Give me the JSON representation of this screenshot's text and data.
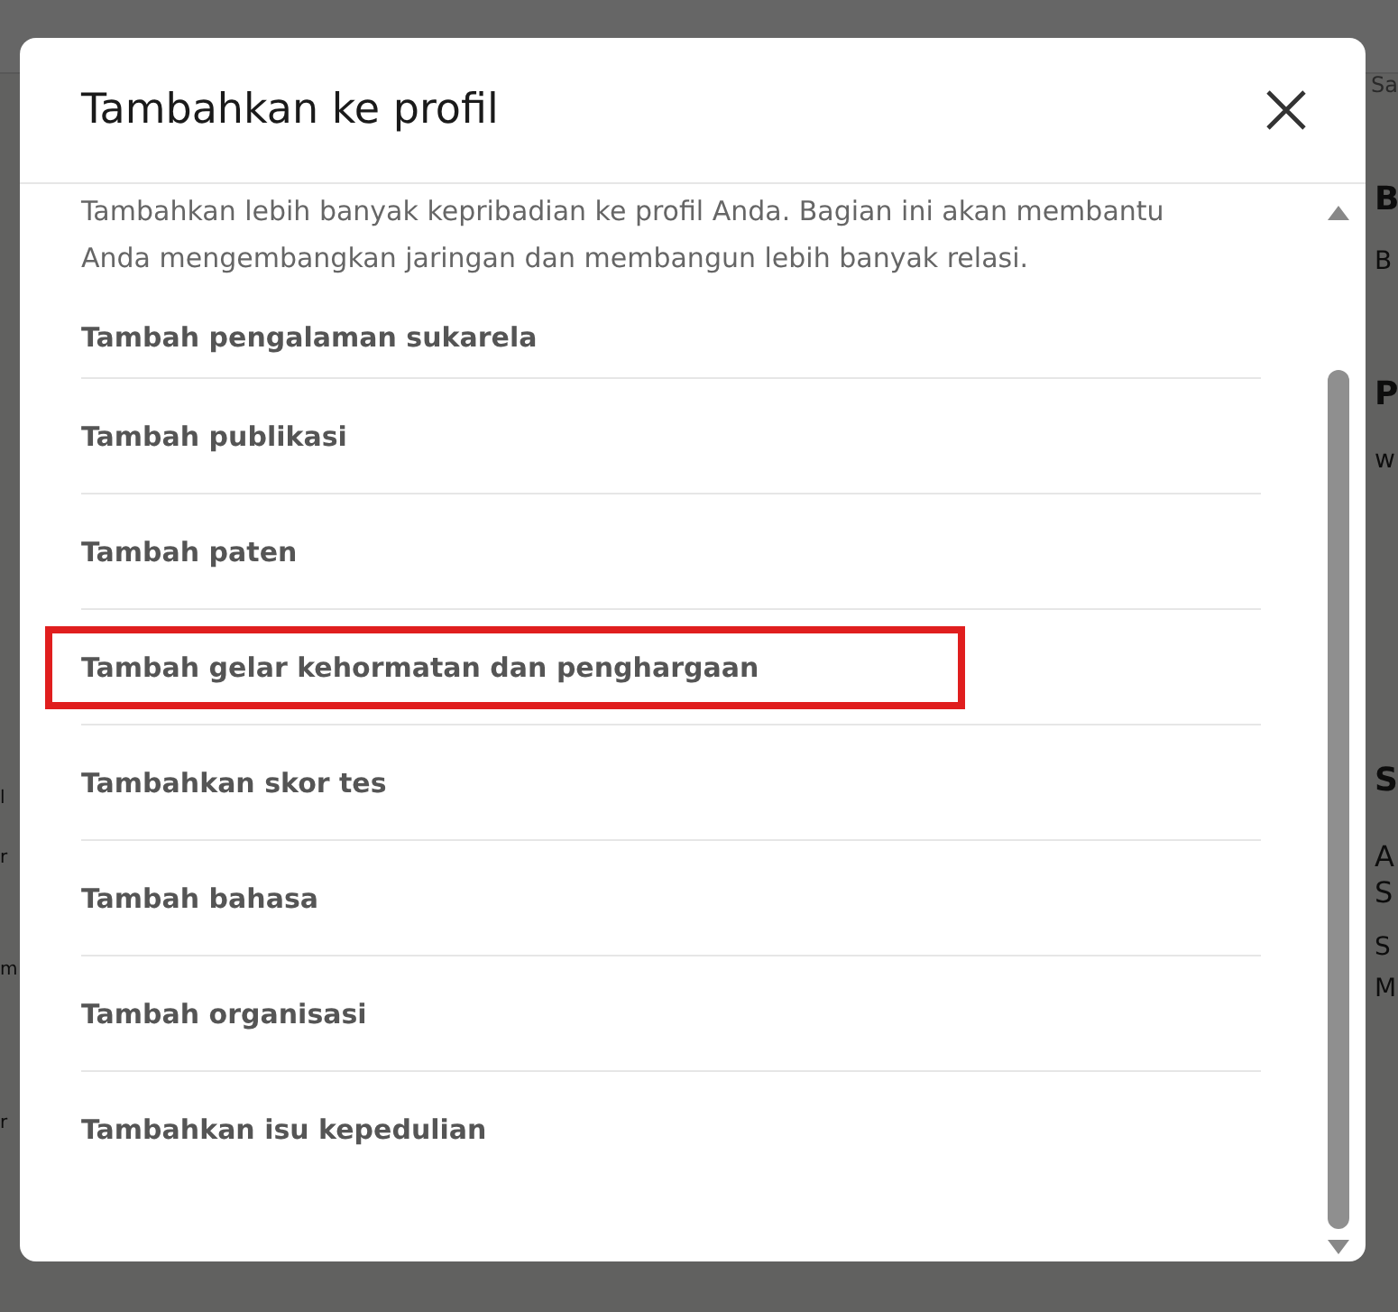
{
  "background": {
    "nav_label": "Sa",
    "right_texts": [
      {
        "text": "B",
        "kind": "heading"
      },
      {
        "text": "B",
        "kind": "body"
      },
      {
        "text": "P",
        "kind": "heading"
      },
      {
        "text": "w",
        "kind": "body"
      },
      {
        "text": "S",
        "kind": "heading"
      },
      {
        "text": "A",
        "kind": "large"
      },
      {
        "text": "S",
        "kind": "large"
      },
      {
        "text": "S",
        "kind": "body"
      },
      {
        "text": "M",
        "kind": "body"
      }
    ],
    "left_texts": [
      "l",
      "r",
      "m",
      "r"
    ]
  },
  "dialog": {
    "title": "Tambahkan ke profil",
    "description": "Tambahkan lebih banyak kepribadian ke profil Anda. Bagian ini akan membantu Anda mengembangkan jaringan dan membangun lebih banyak relasi.",
    "items": [
      {
        "label": "Tambah pengalaman sukarela",
        "highlighted": false
      },
      {
        "label": "Tambah publikasi",
        "highlighted": false
      },
      {
        "label": "Tambah paten",
        "highlighted": false
      },
      {
        "label": "Tambah gelar kehormatan dan penghargaan",
        "highlighted": true
      },
      {
        "label": "Tambahkan skor tes",
        "highlighted": false
      },
      {
        "label": "Tambah bahasa",
        "highlighted": false
      },
      {
        "label": "Tambah organisasi",
        "highlighted": false
      },
      {
        "label": "Tambahkan isu kepedulian",
        "highlighted": false
      }
    ]
  }
}
